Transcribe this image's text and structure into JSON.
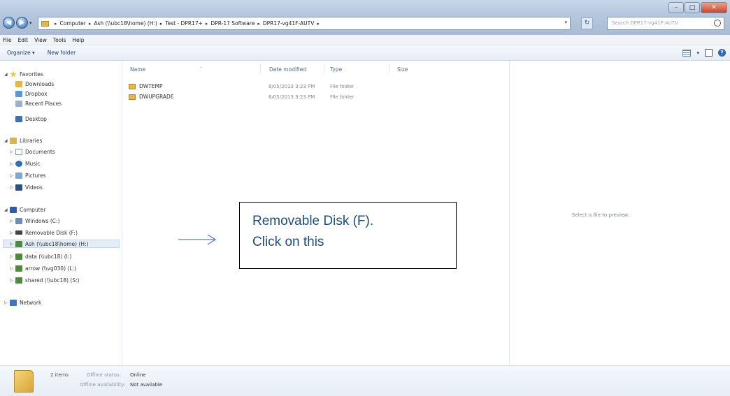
{
  "address_bar": {
    "segments": [
      "Computer",
      "Ash (\\\\ubc18\\home) (H:)",
      "Test - DPR17+",
      "DPR-17 Software",
      "DPR17-vg41F-AUTV"
    ]
  },
  "search": {
    "placeholder": "Search DPR17-vg41F-AUTV"
  },
  "menu": [
    "File",
    "Edit",
    "View",
    "Tools",
    "Help"
  ],
  "toolbar": {
    "organize": "Organize ▾",
    "new_folder": "New folder"
  },
  "nav": {
    "favorites": "Favorites",
    "downloads": "Downloads",
    "dropbox": "Dropbox",
    "recent_places": "Recent Places",
    "desktop": "Desktop",
    "libraries": "Libraries",
    "documents": "Documents",
    "music": "Music",
    "pictures": "Pictures",
    "videos": "Videos",
    "computer": "Computer",
    "windows": "Windows (C:)",
    "removable": "Removable Disk (F:)",
    "ash": "Ash (\\\\ubc18\\home) (H:)",
    "data": "data (\\\\ubc18) (I:)",
    "arrow": "arrow (\\\\vg030) (L:)",
    "shared": "shared (\\\\ubc18) (S:)",
    "network": "Network"
  },
  "columns": {
    "name": "Name",
    "date": "Date modified",
    "type": "Type",
    "size": "Size"
  },
  "files": [
    {
      "name": "DWTEMP",
      "date": "6/05/2013 3:23 PM",
      "type": "File folder"
    },
    {
      "name": "DWUPGRADE",
      "date": "6/05/2013 3:23 PM",
      "type": "File folder"
    }
  ],
  "annotation": {
    "line1": "Removable Disk (F).",
    "line2": "Click on this"
  },
  "preview": {
    "text": "Select a file to preview."
  },
  "details": {
    "count": "2 items",
    "offline_status_label": "Offline status:",
    "offline_status_value": "Online",
    "offline_availability_label": "Offline availability:",
    "offline_availability_value": "Not available"
  },
  "colors": {
    "accent": "#1f4e79",
    "folder": "#e3b64b"
  }
}
